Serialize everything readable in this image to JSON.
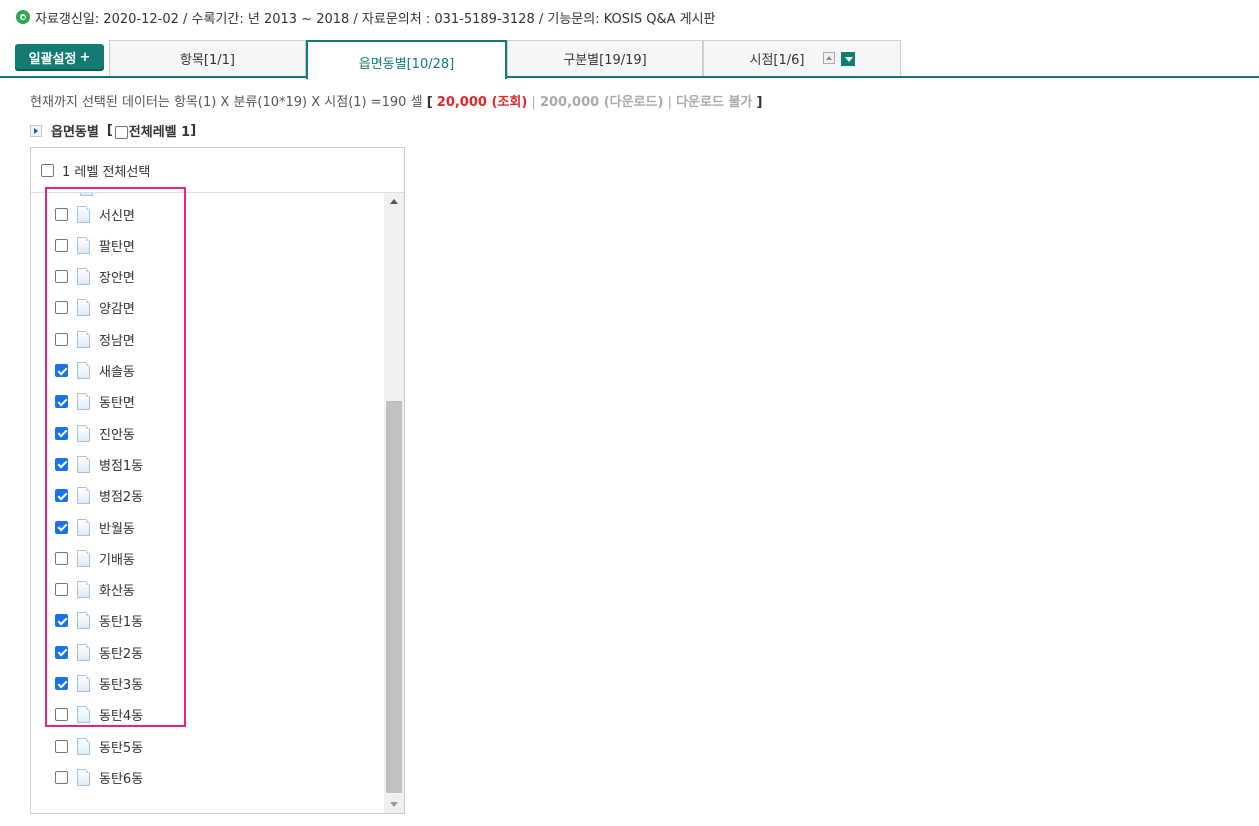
{
  "info": {
    "text": "자료갱신일: 2020-12-02 / 수록기간: 년 2013 ~ 2018 / 자료문의처 : 031-5189-3128 / 기능문의: KOSIS Q&A 게시판"
  },
  "bulk_button": {
    "label": "일괄설정",
    "plus": "+"
  },
  "tabs": [
    {
      "label": "항목[1/1]"
    },
    {
      "label": "읍면동별[10/28]"
    },
    {
      "label": "구분별[19/19]"
    },
    {
      "label": "시점[1/6]"
    }
  ],
  "summary": {
    "prefix": "현재까지 선택된 데이터는 항목(1) X 분류(10*19) X 시점(1) =190 셀",
    "open": "[",
    "count_view": "20,000 (조회)",
    "sep1": "|",
    "count_download": "200,000 (다운로드)",
    "sep2": "|",
    "download_status": "다운로드 불가",
    "close": "]"
  },
  "section": {
    "title": "읍면동별",
    "open": "[",
    "level_label": "전체레벨 1",
    "close": "]"
  },
  "panel": {
    "select_all_label": "1 레벨 전체선택",
    "items": [
      {
        "label": "서신면",
        "checked": false
      },
      {
        "label": "팔탄면",
        "checked": false
      },
      {
        "label": "장안면",
        "checked": false
      },
      {
        "label": "양감면",
        "checked": false
      },
      {
        "label": "정남면",
        "checked": false
      },
      {
        "label": "새솔동",
        "checked": true
      },
      {
        "label": "동탄면",
        "checked": true
      },
      {
        "label": "진안동",
        "checked": true
      },
      {
        "label": "병점1동",
        "checked": true
      },
      {
        "label": "병점2동",
        "checked": true
      },
      {
        "label": "반월동",
        "checked": true
      },
      {
        "label": "기배동",
        "checked": false
      },
      {
        "label": "화산동",
        "checked": false
      },
      {
        "label": "동탄1동",
        "checked": true
      },
      {
        "label": "동탄2동",
        "checked": true
      },
      {
        "label": "동탄3동",
        "checked": true
      },
      {
        "label": "동탄4동",
        "checked": false
      },
      {
        "label": "동탄5동",
        "checked": false
      },
      {
        "label": "동탄6동",
        "checked": false
      }
    ]
  },
  "colors": {
    "accent": "#137c72",
    "highlight": "#e8208a",
    "count_red": "#e0282a",
    "checkbox_blue": "#1a73e8"
  }
}
